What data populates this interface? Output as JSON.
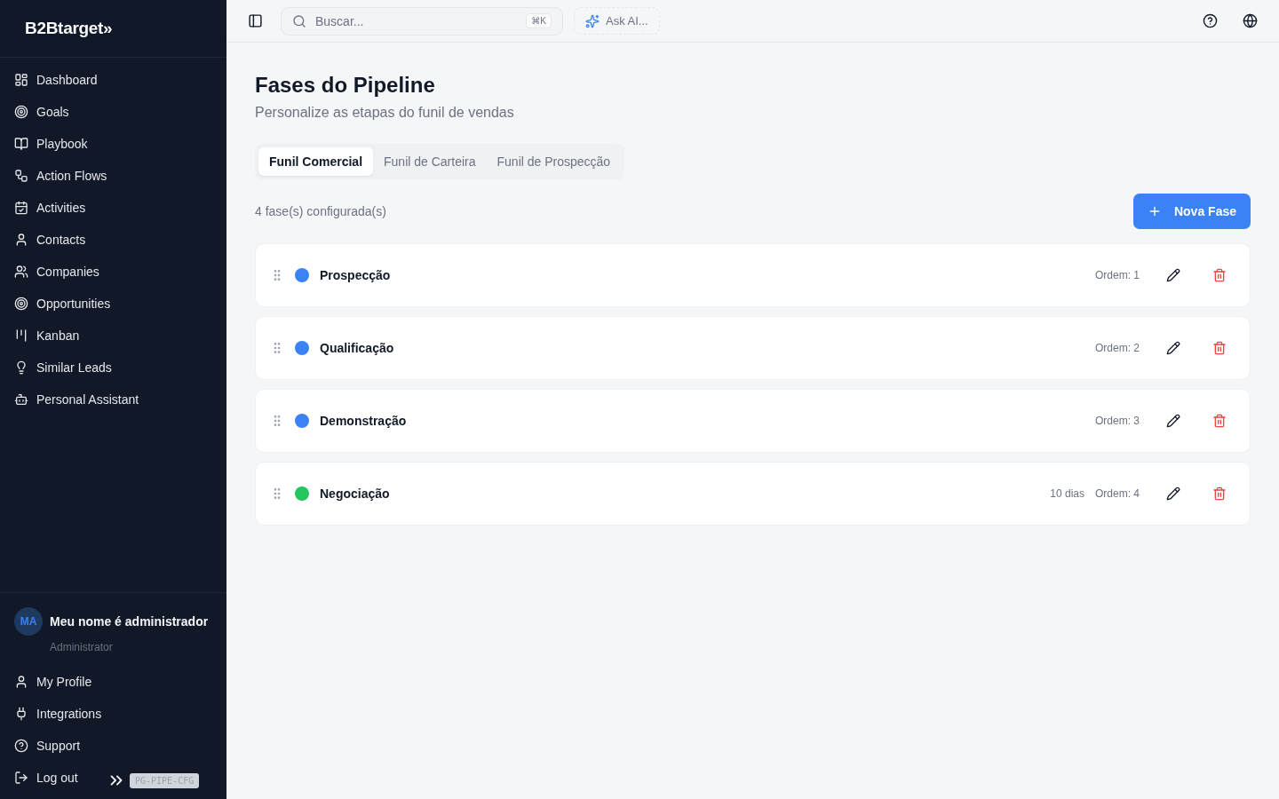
{
  "sidebar": {
    "logo": "B2Btarget",
    "logo_mark": "»",
    "items": [
      {
        "label": "Dashboard"
      },
      {
        "label": "Goals"
      },
      {
        "label": "Playbook"
      },
      {
        "label": "Action Flows"
      },
      {
        "label": "Activities"
      },
      {
        "label": "Contacts"
      },
      {
        "label": "Companies"
      },
      {
        "label": "Opportunities"
      },
      {
        "label": "Kanban"
      },
      {
        "label": "Similar Leads"
      },
      {
        "label": "Personal Assistant"
      }
    ],
    "user": {
      "initials": "MA",
      "name": "Meu nome é administrador",
      "role": "Administrator"
    },
    "footer_items": [
      {
        "label": "My Profile"
      },
      {
        "label": "Integrations"
      },
      {
        "label": "Support"
      },
      {
        "label": "Log out"
      }
    ],
    "overlay_badge": "PG-PIPE-CFG"
  },
  "topbar": {
    "search": {
      "placeholder": "Buscar...",
      "shortcut": "⌘K"
    },
    "ask_ai": "Ask AI..."
  },
  "page": {
    "title": "Fases do Pipeline",
    "subtitle": "Personalize as etapas do funil de vendas",
    "tabs": [
      {
        "label": "Funil Comercial",
        "selected": true
      },
      {
        "label": "Funil de Carteira",
        "selected": false
      },
      {
        "label": "Funil de Prospecção",
        "selected": false
      }
    ],
    "count": "4 fase(s) configurada(s)",
    "new_button": "Nova Fase",
    "phases": [
      {
        "name": "Prospecção",
        "color": "#3b82f6",
        "order": "Ordem: 1"
      },
      {
        "name": "Qualificação",
        "color": "#3b82f6",
        "order": "Ordem: 2"
      },
      {
        "name": "Demonstração",
        "color": "#3b82f6",
        "order": "Ordem: 3"
      },
      {
        "name": "Negociação",
        "color": "#22c55e",
        "duration": "10 dias",
        "order": "Ordem: 4"
      }
    ]
  }
}
